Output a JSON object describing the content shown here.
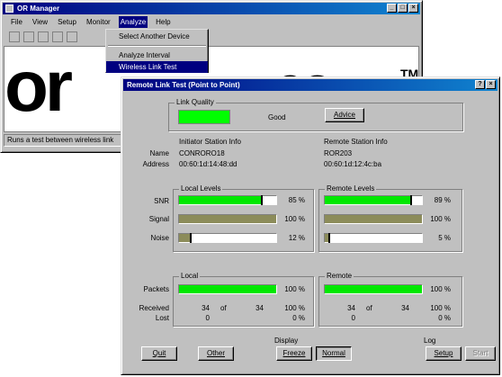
{
  "bg_window": {
    "title": "OR Manager",
    "menu": [
      "File",
      "View",
      "Setup",
      "Monitor",
      "Analyze",
      "Help"
    ],
    "dropdown": {
      "items": [
        "Select Another Device",
        "Analyze Interval",
        "Wireless Link Test"
      ]
    },
    "logo_text": "or",
    "logo_tm": "TM",
    "status_text": "Runs a test between wireless link"
  },
  "dialog": {
    "title": "Remote Link Test (Point to Point)",
    "link_quality": {
      "label": "Link Quality",
      "status": "Good",
      "color": "#00ff00",
      "advice_label": "Advice"
    },
    "labels": {
      "name": "Name",
      "address": "Address"
    },
    "initiator": {
      "header": "Initiator Station Info",
      "name": "CONRORO18",
      "address": "00:60:1d:14:48:dd"
    },
    "remote_station": {
      "header": "Remote Station Info",
      "name": "ROR203",
      "address": "00:60:1d:12:4c:ba"
    },
    "levels": {
      "row_labels": [
        "SNR",
        "Signal",
        "Noise"
      ],
      "local": {
        "label": "Local Levels",
        "snr": "85 %",
        "signal": "100 %",
        "noise": "12 %",
        "snr_frac": 0.85,
        "signal_frac": 1.0,
        "noise_frac": 0.12
      },
      "remote": {
        "label": "Remote Levels",
        "snr": "89 %",
        "signal": "100 %",
        "noise": "5 %",
        "snr_frac": 0.89,
        "signal_frac": 1.0,
        "noise_frac": 0.05
      }
    },
    "packets": {
      "packets_label": "Packets",
      "received_label": "Received",
      "lost_label": "Lost",
      "of_label": "of",
      "local": {
        "label": "Local",
        "percent": "100 %",
        "frac": 1.0,
        "received": "34",
        "total": "34",
        "received_pct": "100 %",
        "lost": "0",
        "lost_pct": "0 %"
      },
      "remote": {
        "label": "Remote",
        "percent": "100 %",
        "frac": 1.0,
        "received": "34",
        "total": "34",
        "received_pct": "100 %",
        "lost": "0",
        "lost_pct": "0 %"
      }
    },
    "buttons": {
      "quit": "Quit",
      "other": "Other",
      "display_label": "Display",
      "freeze": "Freeze",
      "normal": "Normal",
      "log_label": "Log",
      "setup": "Setup",
      "start": "Start"
    },
    "colors": {
      "green": "#00e800",
      "olive": "#8c8c5a",
      "bar_bg": "#ffffff"
    }
  }
}
